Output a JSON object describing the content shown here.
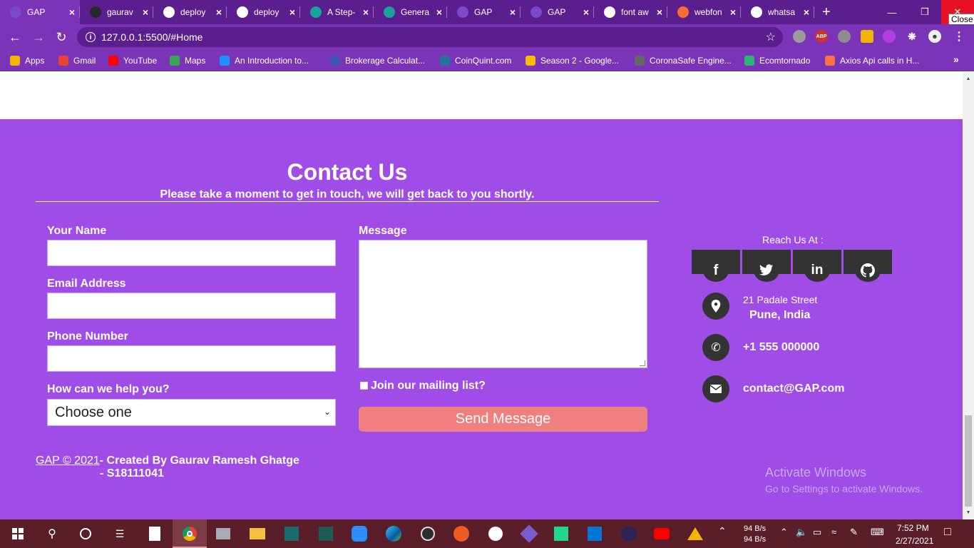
{
  "browser": {
    "tabs": [
      {
        "title": "GAP",
        "active": true
      },
      {
        "title": "gaurav",
        "active": false
      },
      {
        "title": "deploy",
        "active": false
      },
      {
        "title": "deploy",
        "active": false
      },
      {
        "title": "A Step-",
        "active": false
      },
      {
        "title": "Genera",
        "active": false
      },
      {
        "title": "GAP",
        "active": false
      },
      {
        "title": "GAP",
        "active": false
      },
      {
        "title": "font aw",
        "active": false
      },
      {
        "title": "webfon",
        "active": false
      },
      {
        "title": "whatsa",
        "active": false
      }
    ],
    "close_tooltip": "Close",
    "address": "127.0.0.1:5500/#Home",
    "bookmarks": [
      "Apps",
      "Gmail",
      "YouTube",
      "Maps",
      "An Introduction to...",
      "Brokerage Calculat...",
      "CoinQuint.com",
      "Season 2 - Google...",
      "CoronaSafe Engine...",
      "Ecomtornado",
      "Axios Api calls in H..."
    ],
    "extensions": {
      "abp": "ABP"
    }
  },
  "contact": {
    "title": "Contact Us",
    "subtitle": "Please take a moment to get in touch, we will get back to you shortly.",
    "form": {
      "name_label": "Your Name",
      "email_label": "Email Address",
      "phone_label": "Phone Number",
      "help_label": "How can we help you?",
      "help_selected": "Choose one",
      "message_label": "Message",
      "mailing_label": "Join our mailing list?",
      "send_label": "Send Message"
    },
    "reach": {
      "label": "Reach Us At :",
      "social": [
        "facebook-icon",
        "twitter-icon",
        "linkedin-icon",
        "github-icon"
      ],
      "address_line1": "21 Padale Street",
      "address_line2": "Pune, India",
      "phone": "+1 555 000000",
      "email": "contact@GAP.com"
    },
    "footer": {
      "copyright": "GAP © 2021",
      "credit": "- Created By Gaurav Ramesh Ghatge",
      "id": "- S18111041"
    }
  },
  "watermark": {
    "line1": "Activate Windows",
    "line2": "Go to Settings to activate Windows."
  },
  "taskbar": {
    "net_up": "94 B/s",
    "net_down": "94 B/s",
    "time": "7:52 PM",
    "date": "2/27/2021"
  },
  "colors": {
    "contact_bg": "#9f4de6",
    "send_button": "#f08080",
    "browser_frame": "#7a34b8"
  }
}
